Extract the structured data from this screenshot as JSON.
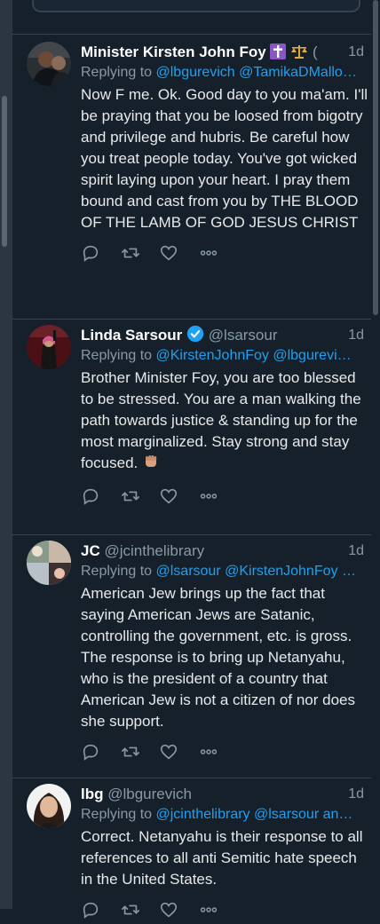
{
  "tweets": [
    {
      "name": "Minister Kirsten John Foy",
      "name_suffix": "(",
      "handle": "",
      "time": "1d",
      "reply_prefix": "Replying to",
      "reply_mentions": "@lbgurevich @TamikaDMallo…",
      "text": "Now F me. Ok. Good day to you ma'am. I'll be praying that you be loosed from bigotry and privilege and hubris. Be careful how you treat people today. You've got wicked spirit laying upon your heart. I pray them bound and cast from you by THE BLOOD OF THE LAMB OF GOD JESUS CHRIST",
      "icons": [
        "latin-cross-emoji",
        "scales-emoji"
      ]
    },
    {
      "name": "Linda Sarsour",
      "handle": "@lsarsour",
      "time": "1d",
      "reply_prefix": "Replying to",
      "reply_mentions": "@KirstenJohnFoy @lbgurevi…",
      "text": "Brother Minister Foy, you are too blessed to be stressed. You are a man walking the path towards justice & standing up for the most marginalized. Stay strong and stay focused.",
      "icons": [
        "verified-badge-icon",
        "raised-fist-emoji"
      ]
    },
    {
      "name": "JC",
      "handle": "@jcinthelibrary",
      "time": "1d",
      "reply_prefix": "Replying to",
      "reply_mentions": "@lsarsour @KirstenJohnFoy …",
      "text": "American Jew brings up the fact that saying American Jews are Satanic, controlling the government, etc. is gross. The response is to bring up Netanyahu, who is the president of a country that American Jew is not a citizen of nor does she support."
    },
    {
      "name": "lbg",
      "handle": "@lbgurevich",
      "time": "1d",
      "reply_prefix": "Replying to",
      "reply_mentions": "@jcinthelibrary @lsarsour an…",
      "text": "Correct. Netanyahu is their response to all references to all anti Semitic hate speech in the United States."
    }
  ],
  "action_icons": [
    "reply-icon",
    "retweet-icon",
    "like-icon",
    "more-icon"
  ],
  "colors": {
    "background": "#15202b",
    "divider": "#38444d",
    "link": "#1da1f2",
    "secondary_text": "#8899a6",
    "verified": "#1da1f2"
  }
}
